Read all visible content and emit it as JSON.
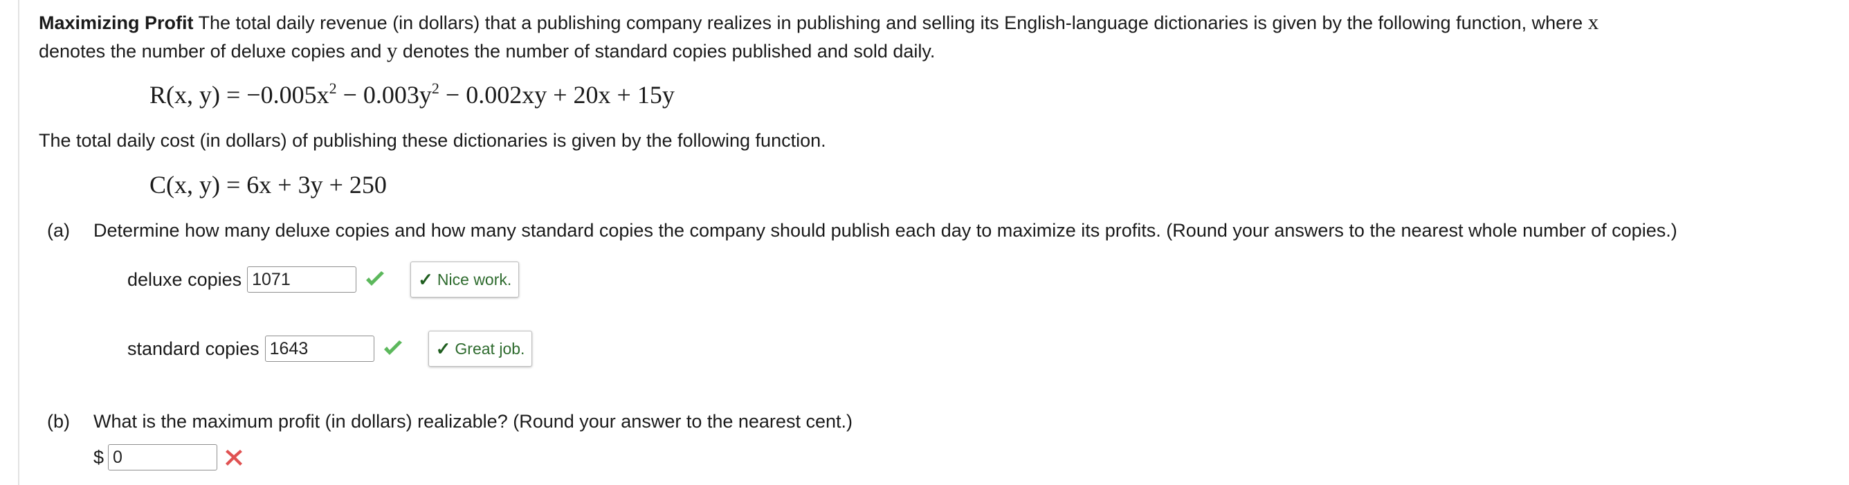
{
  "intro": {
    "title": "Maximizing Profit",
    "text_1": " The total daily revenue (in dollars) that a publishing company realizes in publishing and selling its English-language dictionaries is given by the following function, where ",
    "var_x": "x",
    "text_2": "denotes the number of deluxe copies and ",
    "var_y": "y",
    "text_3": " denotes the number of standard copies published and sold daily."
  },
  "revenue_formula": {
    "part1": "R(x, y) = −0.005x",
    "exp1": "2",
    "part2": " − 0.003y",
    "exp2": "2",
    "part3": " − 0.002xy + 20x + 15y"
  },
  "cost_intro": "The total daily cost (in dollars) of publishing these dictionaries is given by the following function.",
  "cost_formula": "C(x, y) = 6x + 3y + 250",
  "part_a": {
    "label": "(a)",
    "question": "Determine how many deluxe copies and how many standard copies the company should publish each day to maximize its profits. (Round your answers to the nearest whole number of copies.)",
    "deluxe": {
      "label": "deluxe copies",
      "value": "1071",
      "status_icon": "check-icon",
      "feedback": "Nice work."
    },
    "standard": {
      "label": "standard copies",
      "value": "1643",
      "status_icon": "check-icon",
      "feedback": "Great job."
    }
  },
  "part_b": {
    "label": "(b)",
    "question": "What is the maximum profit (in dollars) realizable? (Round your answer to the nearest cent.)",
    "currency": "$",
    "value": "0",
    "status_icon": "x-icon"
  },
  "colors": {
    "correct": "#5cb85c",
    "incorrect": "#e05252",
    "feedback_text": "#2e6b2e"
  }
}
